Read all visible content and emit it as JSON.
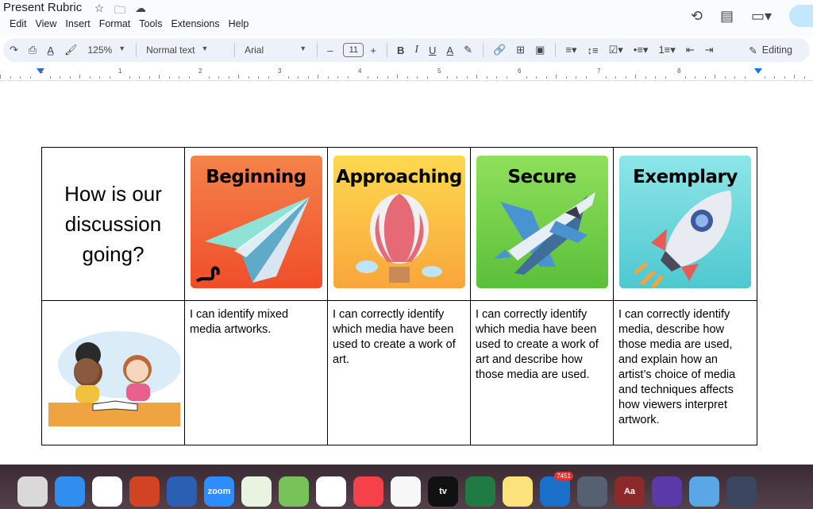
{
  "doc": {
    "title": "Present Rubric",
    "title_icons": [
      "star-icon",
      "folder-move-icon",
      "cloud-status-icon"
    ]
  },
  "menu": [
    "Edit",
    "View",
    "Insert",
    "Format",
    "Tools",
    "Extensions",
    "Help"
  ],
  "toolbar": {
    "zoom": "125%",
    "style": "Normal text",
    "font": "Arial",
    "font_size": "11",
    "minus": "–",
    "plus": "+",
    "bold": "B",
    "italic": "I",
    "underline": "U",
    "text_color": "A",
    "editing": "Editing"
  },
  "ruler": {
    "numbers": [
      "1",
      "1",
      "2",
      "3",
      "4",
      "5",
      "6",
      "7",
      "8"
    ]
  },
  "rubric": {
    "question": "How is our discussion going?",
    "levels": [
      {
        "label": "Beginning",
        "description": "I can identify mixed media artworks."
      },
      {
        "label": "Approaching",
        "description": "I can correctly identify which media have been used to create a work of art."
      },
      {
        "label": "Secure",
        "description": "I can correctly identify which media have been used to create a work of art and describe how those media are used."
      },
      {
        "label": "Exemplary",
        "description": "I can correctly identify media, describe how those media are used, and explain how an artist’s choice of media and techniques affects how viewers interpret artwork."
      }
    ]
  },
  "dock": {
    "apps": [
      "Launchpad",
      "Safari",
      "Chrome",
      "PowerPoint",
      "Word",
      "zoom",
      "Globe",
      "Maps",
      "Photos",
      "News",
      "Freeform",
      "tv",
      "Excel",
      "Notes",
      "Outlook",
      "QuickTime",
      "Dictionary",
      "iMovie",
      "Folder",
      "Screen"
    ],
    "outlook_badge": "7451",
    "tv_label": "tv",
    "dict_label": "Aa",
    "zoom_label": "zoom"
  },
  "colors": {
    "beginning": "#ef5a30",
    "approaching": "#fbc244",
    "secure": "#73cf4b",
    "exemplary": "#6cd8dc",
    "toolbar_bg": "#edf2fa"
  }
}
